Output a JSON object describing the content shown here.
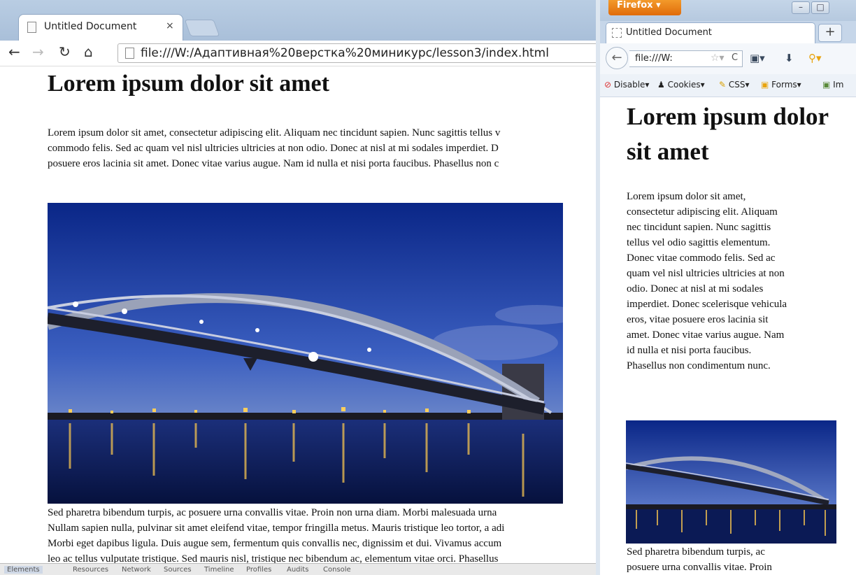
{
  "left_window": {
    "tab_title": "Untitled Document",
    "tab_close": "×",
    "url": "file:///W:/Адаптивная%20верстка%20миникурс/lesson3/index.html",
    "page": {
      "heading": "Lorem ipsum dolor sit amet",
      "para1_lines": [
        "Lorem ipsum dolor sit amet, consectetur adipiscing elit. Aliquam nec tincidunt sapien. Nunc sagittis tellus v",
        "commodo felis. Sed ac quam vel nisl ultricies ultricies at non odio. Donec at nisl at mi sodales imperdiet. D",
        "posuere eros lacinia sit amet. Donec vitae varius augue. Nam id nulla et nisi porta faucibus. Phasellus non c"
      ],
      "para2_lines": [
        "Sed pharetra bibendum turpis, ac posuere urna convallis vitae. Proin non urna diam. Morbi malesuada urna",
        "Nullam sapien nulla, pulvinar sit amet eleifend vitae, tempor fringilla metus. Mauris tristique leo tortor, a adi",
        "Morbi eget dapibus ligula. Duis augue sem, fermentum quis convallis nec, dignissim et dui. Vivamus accum",
        "leo ac tellus vulputate tristique. Sed mauris nisl, tristique nec bibendum ac, elementum vitae orci. Phasellus"
      ]
    },
    "devtools_tabs": [
      "Elements",
      "Resources",
      "Network",
      "Sources",
      "Timeline",
      "Profiles",
      "Audits",
      "Console"
    ]
  },
  "right_window": {
    "app_button": "Firefox ▾",
    "tab_title": "Untitled Document",
    "new_tab": "+",
    "url": "file:///W:",
    "addons": [
      "Disable▾",
      "Cookies▾",
      "CSS▾",
      "Forms▾",
      "Im"
    ],
    "page": {
      "heading": "Lorem ipsum dolor sit amet",
      "para1_lines": [
        "Lorem ipsum dolor sit amet,",
        "consectetur adipiscing elit. Aliquam",
        "nec tincidunt sapien. Nunc sagittis",
        "tellus vel odio sagittis elementum.",
        "Donec vitae commodo felis. Sed ac",
        "quam vel nisl ultricies ultricies at non",
        "odio. Donec at nisl at mi sodales",
        "imperdiet. Donec scelerisque vehicula",
        "eros, vitae posuere eros lacinia sit",
        "amet. Donec vitae varius augue. Nam",
        "id nulla et nisi porta faucibus.",
        "Phasellus non condimentum nunc."
      ],
      "para2_lines": [
        "Sed pharetra bibendum turpis, ac",
        "posuere urna convallis vitae. Proin"
      ]
    }
  },
  "colors": {
    "sky_top": "#0b2a8a",
    "sky_bottom": "#4d70c8",
    "water": "#0a1c5c",
    "firefox_orange": "#e8780f"
  }
}
